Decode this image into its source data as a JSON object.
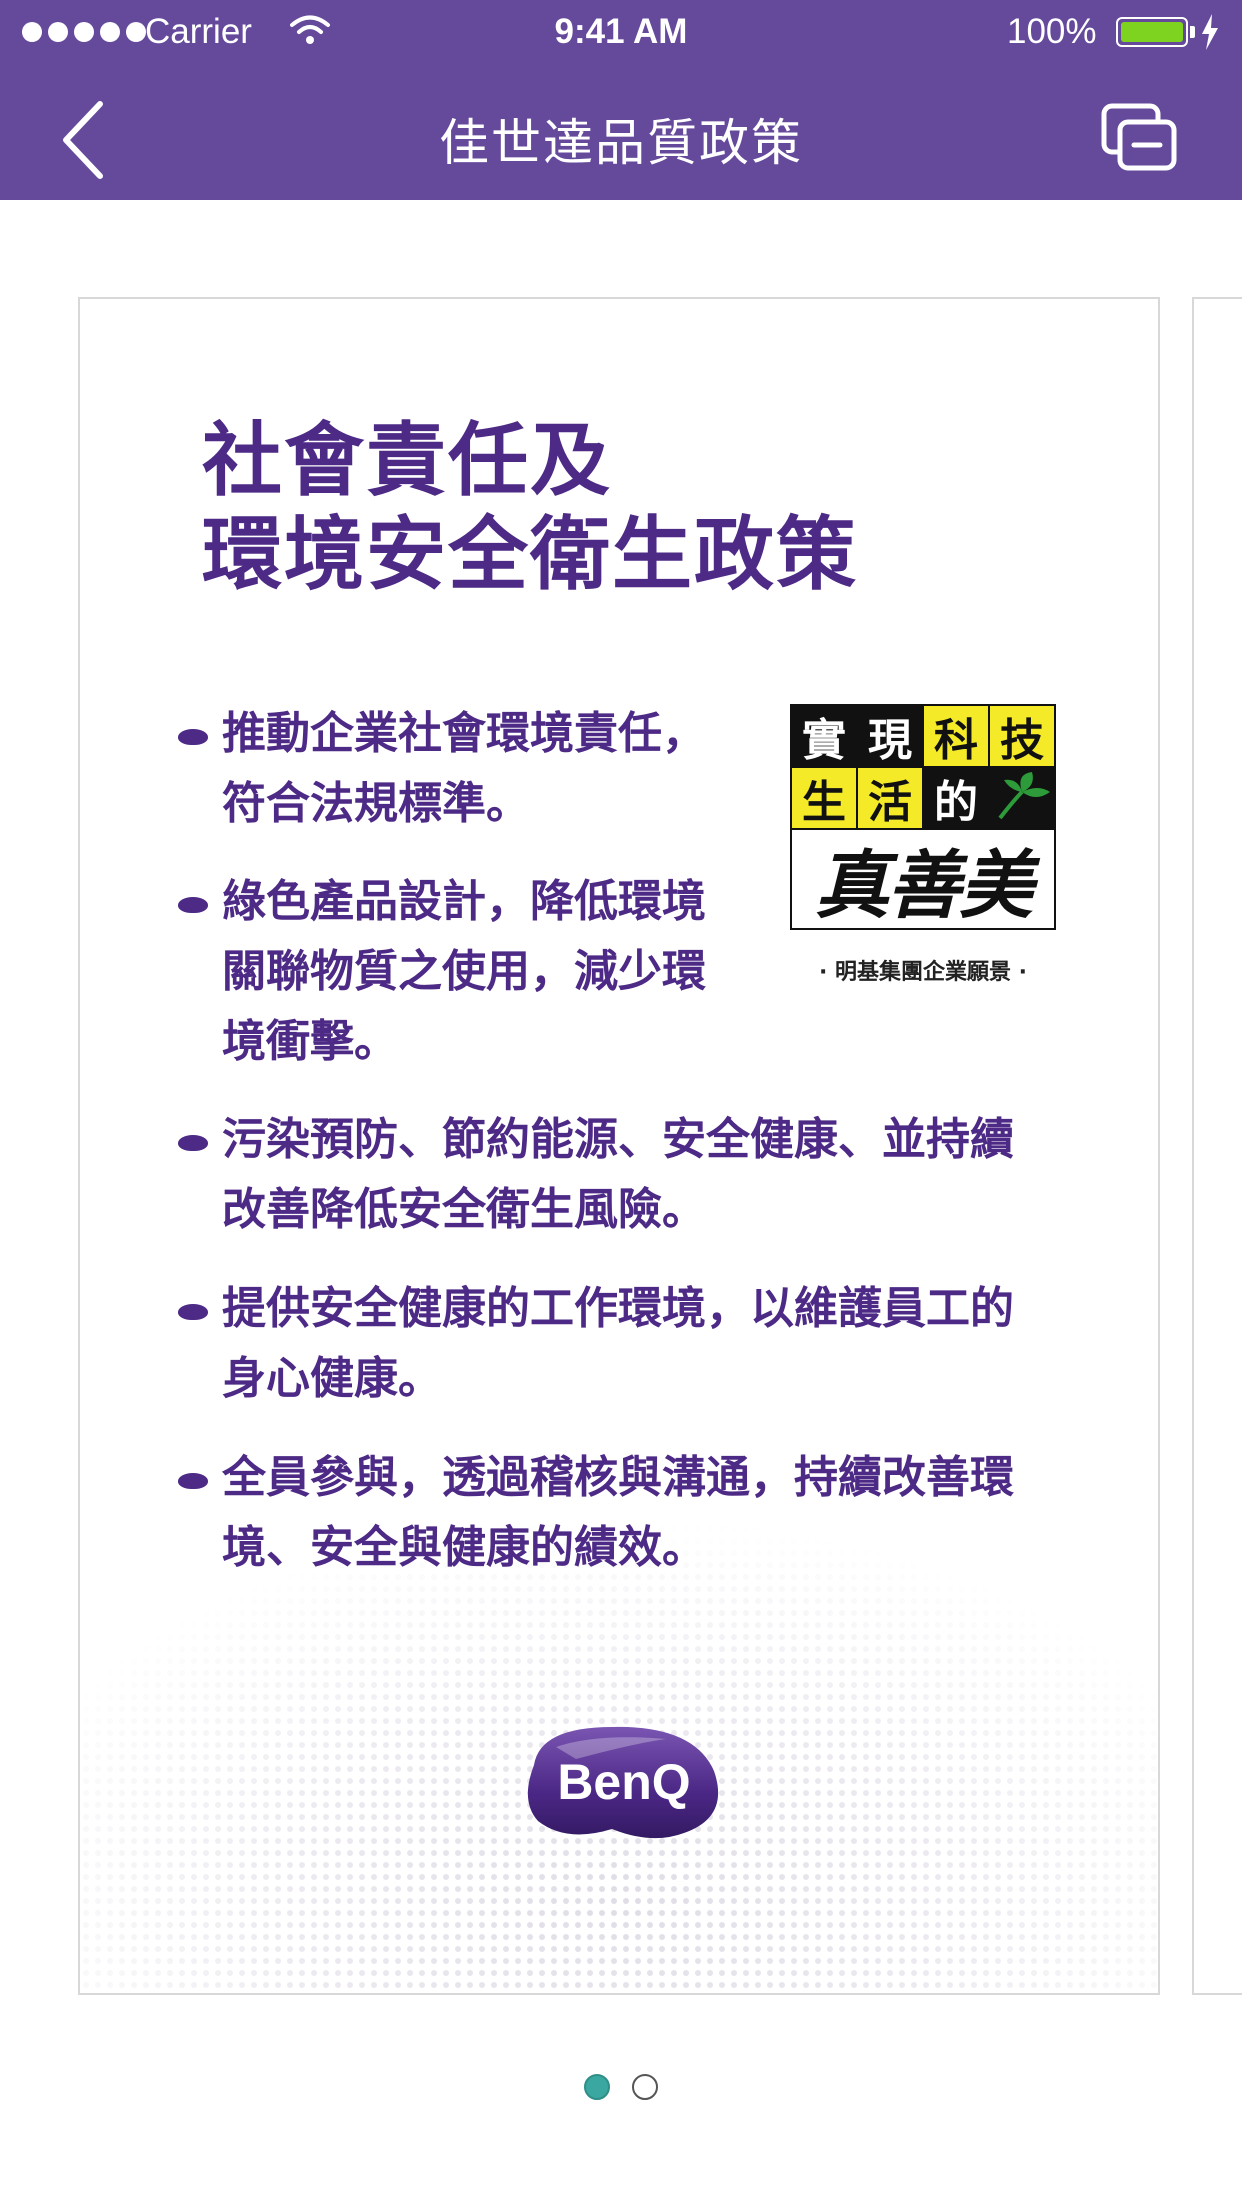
{
  "status_bar": {
    "carrier": "Carrier",
    "time": "9:41 AM",
    "battery_percent": "100%",
    "battery_level": 1.0,
    "battery_color": "#7ed321",
    "icons": [
      "signal-dots-icon",
      "wifi-icon",
      "battery-icon",
      "charging-bolt-icon"
    ]
  },
  "nav": {
    "title": "佳世達品質政策",
    "back_icon": "chevron-left-icon",
    "action_icon": "pages-icon",
    "background": "#654a9c"
  },
  "card": {
    "heading": [
      "社會責任及",
      "環境安全衛生政策"
    ],
    "bullets": [
      [
        "推動企業社會環境責任，",
        "符合法規標準。"
      ],
      [
        "綠色產品設計，降低環境",
        "關聯物質之使用，減少環",
        "境衝擊。"
      ],
      [
        "污染預防、節約能源、安全健康、並持續",
        "改善降低安全衛生風險。"
      ],
      [
        "提供安全健康的工作環境，以維護員工的",
        "身心健康。"
      ],
      [
        "全員參與，透過稽核與溝通，持續改善環",
        "境、安全與健康的績效。"
      ]
    ],
    "accent_color": "#4d2a86",
    "slogan": {
      "row1": [
        "實",
        "現",
        "科",
        "技"
      ],
      "row2": [
        "生",
        "活",
        "的"
      ],
      "calligraphy": "真善美",
      "caption": "· 明基集團企業願景 ·"
    },
    "logo_text": "BenQ"
  },
  "pager": {
    "total": 2,
    "current": 1,
    "active_color": "#3aa8a0"
  }
}
